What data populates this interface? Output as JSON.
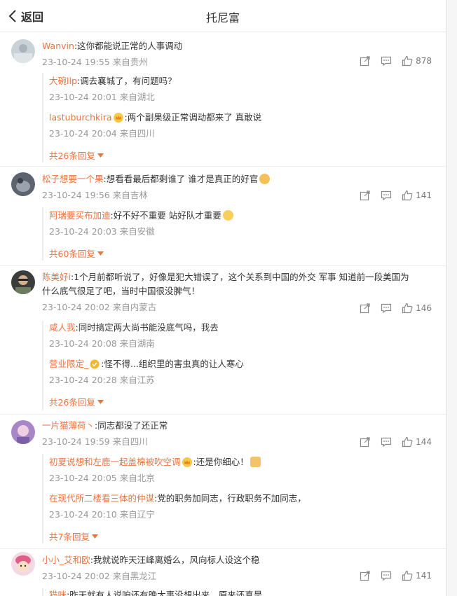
{
  "header": {
    "back_label": "返回",
    "title": "托尼富"
  },
  "comments": [
    {
      "username": "Wanvin",
      "text": ":这你都能说正常的人事调动",
      "meta": "23-10-24 19:55 来自贵州",
      "likes": "878",
      "replies": [
        {
          "username": "大碗llp",
          "text": ":调去襄城了，有问题吗？",
          "meta": "23-10-24 20:01 来自湖北"
        },
        {
          "username": "lastuburchkira",
          "text": ":两个副果级正常调动都来了 真敢说",
          "meta": "23-10-24 20:04 来自四川"
        }
      ],
      "more": "共26条回复"
    },
    {
      "username": "松子想要一个果",
      "text": ":想看看最后都剩谁了 谁才是真正的好官",
      "meta": "23-10-24 19:56 来自吉林",
      "likes": "141",
      "replies": [
        {
          "username": "阿瑞要买布加迪",
          "text": ":好不好不重要 站好队才重要",
          "meta": "23-10-24 20:03 来自安徽"
        }
      ],
      "more": "共60条回复"
    },
    {
      "username": "陈美好i",
      "text_line1": ":1个月前都听说了，好像是犯大错误了，这个关系到中国的外交 军事  知道前一段美国为",
      "text_line2": "什么底气很足了吧，当时中国很没脾气！",
      "meta": "23-10-24 20:02 来自内蒙古",
      "likes": "146",
      "replies": [
        {
          "username": "咸人我",
          "text": ":同时搞定两大尚书能没底气吗，我去",
          "meta": "23-10-24 20:08 来自湖南"
        },
        {
          "username": "营业限定_",
          "text": ":怪不得...组织里的害虫真的让人寒心",
          "meta": "23-10-24 20:28 来自江苏"
        }
      ],
      "more": "共26条回复"
    },
    {
      "username": "一片猫薄荷丶",
      "text": ":同志都没了还正常",
      "meta": "23-10-24 19:59 来自四川",
      "likes": "144",
      "replies": [
        {
          "username": "初夏说想和左鹿一起盖棉被吹空调",
          "text": ":还是你细心！",
          "meta": "23-10-24 20:05 来自北京"
        },
        {
          "username": "在现代所二楼看三体的仲谋",
          "text": ":党的职务加同志，行政职务不加同志，",
          "meta": "23-10-24 20:10 来自辽宁"
        }
      ],
      "more": "共7条回复"
    },
    {
      "username": "小小_艾和欧",
      "text": ":我就说昨天汪峰离婚么，风向标人设这个稳",
      "meta": "23-10-24 20:02 来自黑龙江",
      "likes": "141",
      "replies": [
        {
          "username": "猫咪",
          "text": ":昨天就有人说咱还有晚大事没想出来，原来还真是",
          "meta": ""
        }
      ],
      "more": ""
    }
  ],
  "colors": {
    "accent": "#eb7340",
    "meta": "#999999"
  }
}
